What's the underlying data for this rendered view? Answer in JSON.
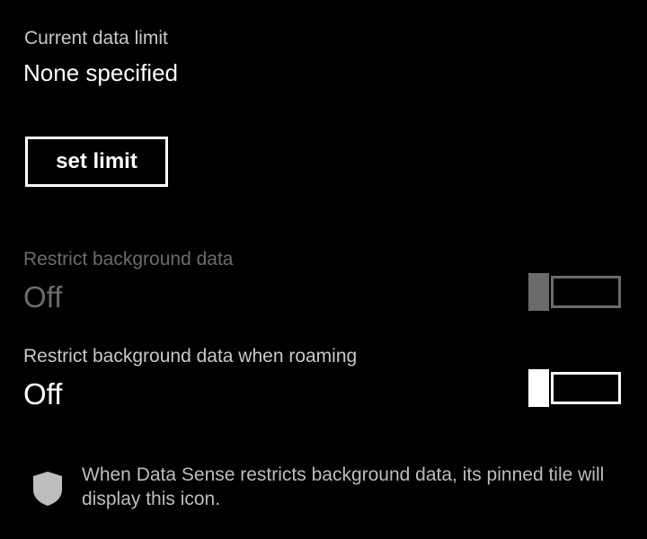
{
  "data_limit": {
    "label": "Current data limit",
    "value": "None specified",
    "button_label": "set limit"
  },
  "restrict_background": {
    "label": "Restrict background data",
    "value": "Off",
    "toggle_on": false,
    "disabled": true
  },
  "restrict_roaming": {
    "label": "Restrict background data when roaming",
    "value": "Off",
    "toggle_on": false,
    "disabled": false
  },
  "info": {
    "icon": "shield-icon",
    "text": "When Data Sense restricts background data, its pinned tile will display this icon."
  },
  "colors": {
    "background": "#000000",
    "text": "#ffffff",
    "disabled": "#6b6b6b"
  }
}
